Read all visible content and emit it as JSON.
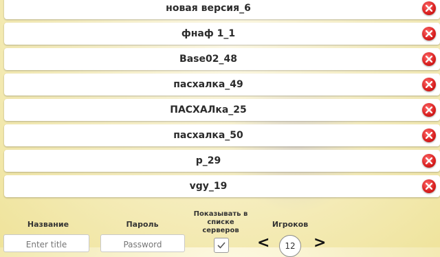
{
  "servers": [
    {
      "name": "новая версия_6"
    },
    {
      "name": "фнаф 1_1"
    },
    {
      "name": "Base02_48"
    },
    {
      "name": "пасхалка_49"
    },
    {
      "name": "ПАСХАЛка_25"
    },
    {
      "name": "пасхалка_50"
    },
    {
      "name": "p_29"
    },
    {
      "name": "vgy_19"
    }
  ],
  "form": {
    "name_label": "Название",
    "name_placeholder": "Enter title",
    "password_label": "Пароль",
    "password_placeholder": "Password",
    "show_label": "Показывать в списке серверов",
    "show_checked": true,
    "players_label": "Игроков",
    "players_value": "12"
  },
  "colors": {
    "delete": "#d81f1f",
    "background": "#f7f0c8"
  }
}
